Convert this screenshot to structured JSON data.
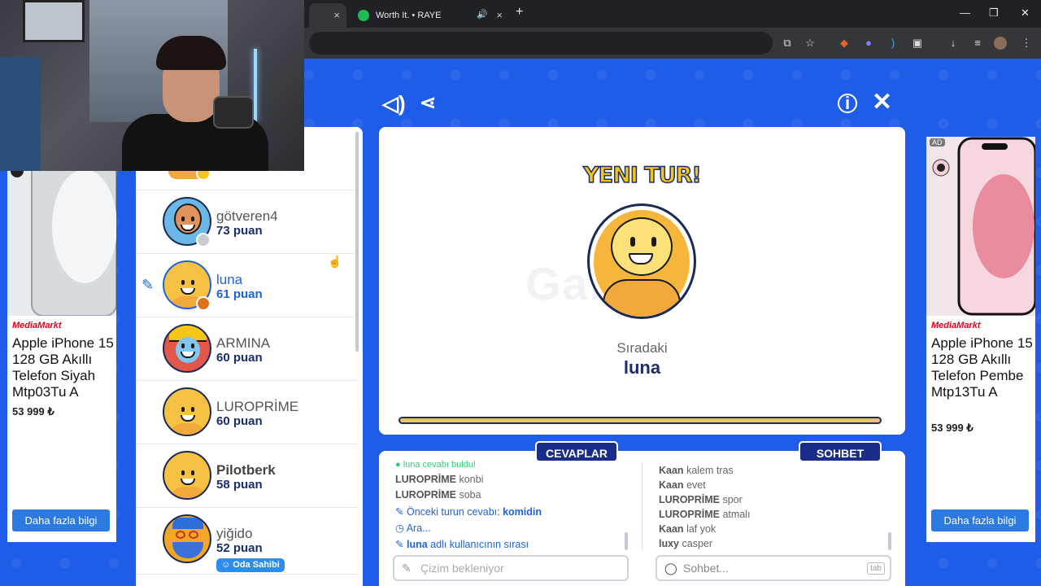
{
  "browser": {
    "tab_active_title": "",
    "tab_spotify_title": "Worth It. • RAYE",
    "new_tab": "+",
    "close": "×",
    "window_controls": [
      "—",
      "❐",
      "✕"
    ]
  },
  "ads": {
    "left": {
      "brand": "MediaMarkt",
      "title": "Apple iPhone 15 128 GB Akıllı Telefon Siyah Mtp03Tu A",
      "price": "53 999 ₺",
      "cta": "Daha fazla bilgi"
    },
    "right": {
      "brand": "MediaMarkt",
      "title": "Apple iPhone 15 128 GB Akıllı Telefon Pembe Mtp13Tu A",
      "price": "53 999 ₺",
      "cta": "Daha fazla bilgi",
      "ad_badge": "AD"
    }
  },
  "players": [
    {
      "name": "götveren4",
      "score": "73 puan",
      "status_color": "#c9ccd3"
    },
    {
      "name": "luna",
      "score": "61 puan",
      "status_color": "#e0701e",
      "drawing": true
    },
    {
      "name": "ARMINA",
      "score": "60 puan",
      "status_color": ""
    },
    {
      "name": "LUROPRİME",
      "score": "60 puan",
      "status_color": ""
    },
    {
      "name": "Pilotberk",
      "score": "58 puan",
      "status_color": ""
    },
    {
      "name": "yiğido",
      "score": "52 puan",
      "status_color": "",
      "badge": "Oda Sahibi"
    }
  ],
  "card": {
    "heading": "YENI TUR!",
    "watermark": "Gartic",
    "next_label": "Sıradaki",
    "next_name": "luna"
  },
  "answers": {
    "header": "CEVAPLAR",
    "messages": [
      {
        "user": "",
        "text": "luna cevabı buldu!"
      },
      {
        "user": "LUROPRİME",
        "text": "konbi"
      },
      {
        "user": "LUROPRİME",
        "text": "soba"
      },
      {
        "user": "",
        "text": "Önceki turun cevabı: ",
        "highlight": "komidin"
      },
      {
        "user": "",
        "text": "Ara..."
      },
      {
        "user": "luna",
        "text": " adlı kullanıcının sırası"
      }
    ],
    "input_placeholder": "Çizim bekleniyor"
  },
  "chat": {
    "header": "SOHBET",
    "messages": [
      {
        "user": "Kaan",
        "text": "kalem tras"
      },
      {
        "user": "Kaan",
        "text": "evet"
      },
      {
        "user": "LUROPRİME",
        "text": "spor"
      },
      {
        "user": "LUROPRİME",
        "text": "atmalı"
      },
      {
        "user": "Kaan",
        "text": "laf yok"
      },
      {
        "user": "luxy",
        "text": "casper"
      }
    ],
    "input_placeholder": "Sohbet...",
    "tab_hint": "tab"
  },
  "colors": {
    "accent": "#1e63d6",
    "background": "#1f5ce8",
    "navy": "#1b2d8a",
    "gold": "#f5c518"
  }
}
